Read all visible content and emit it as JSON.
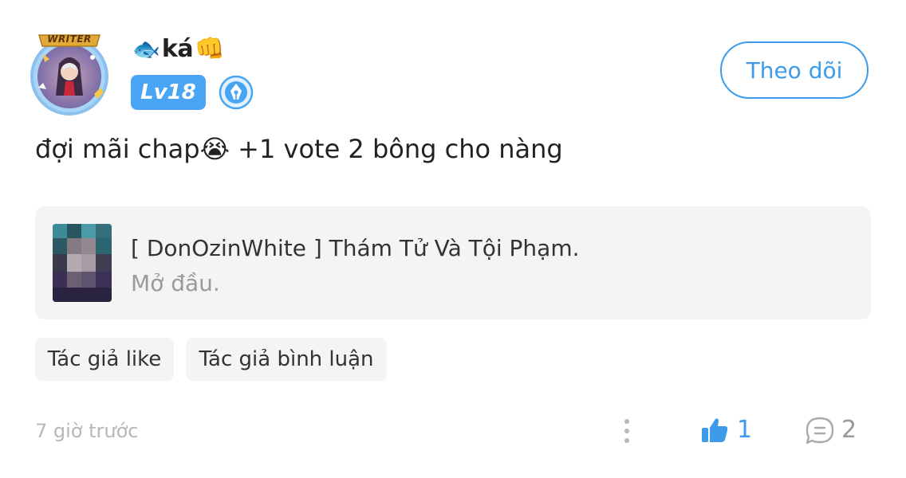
{
  "user": {
    "avatar_badge": "WRITER",
    "name_emoji_prefix": "🐟",
    "name": "ká",
    "name_emoji_suffix": "👊",
    "level": "Lv18",
    "role_icon": "pen-nib-icon"
  },
  "follow_button": {
    "label": "Theo dõi"
  },
  "comment": {
    "text": "đợi mãi chap",
    "emoji": "😭",
    "text_after": " +1 vote 2 bông cho nàng"
  },
  "reference": {
    "title": "[ DonOzinWhite ] Thám Tử Và Tội Phạm.",
    "subtitle": "Mở đầu."
  },
  "tags": [
    "Tác giả like",
    "Tác giả bình luận"
  ],
  "footer": {
    "time": "7 giờ trước",
    "like_count": "1",
    "comment_count": "2"
  },
  "colors": {
    "accent": "#3d9be9",
    "level_badge": "#4aa4f4",
    "card_bg": "#f4f4f4",
    "muted": "#b8b8b8"
  }
}
